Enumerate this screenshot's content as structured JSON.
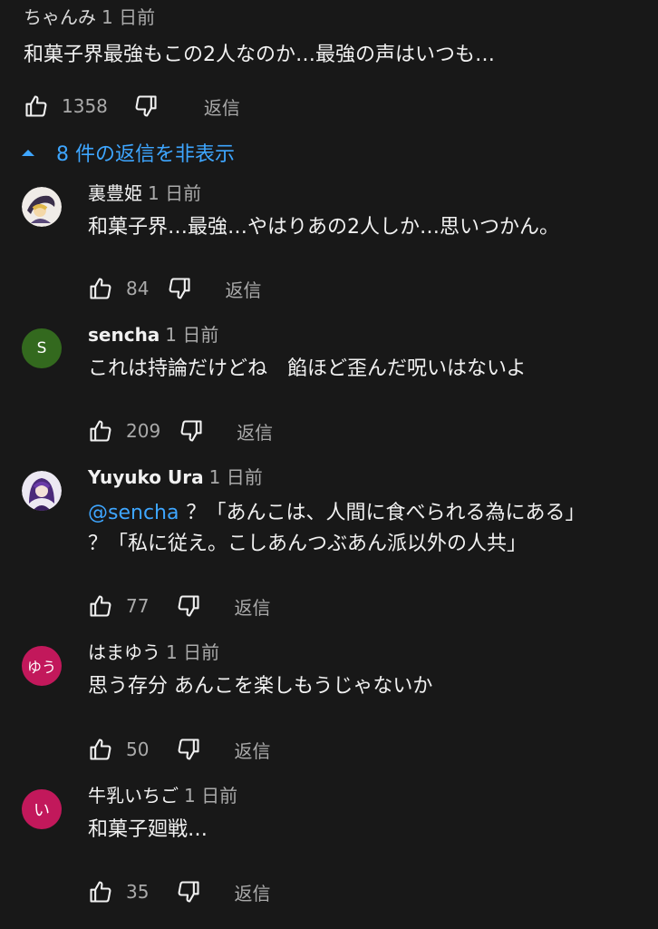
{
  "top_comment": {
    "author": "ちゃんみ",
    "time": "1 日前",
    "text": "和菓子界最強もこの2人なのか…最強の声はいつも…",
    "likes": "1358",
    "reply_label": "返信"
  },
  "replies_toggle": {
    "label": "8 件の返信を非表示"
  },
  "replies": [
    {
      "author": "裏豊姫",
      "time": "1 日前",
      "avatar_type": "image",
      "text": "和菓子界…最強…やはりあの2人しか…思いつかん。",
      "likes": "84",
      "reply_label": "返信"
    },
    {
      "author": "sencha",
      "time": "1 日前",
      "avatar_letter": "S",
      "avatar_color": "#33691e",
      "text": "これは持論だけどね　餡ほど歪んだ呪いはないよ",
      "likes": "209",
      "reply_label": "返信"
    },
    {
      "author": "Yuyuko Ura",
      "time": "1 日前",
      "avatar_type": "image",
      "mention": "@sencha",
      "text_line1": "？「あんこは、人間に食べられる為にある」",
      "text_line2": "？「私に従え。こしあんつぶあん派以外の人共」",
      "likes": "77",
      "reply_label": "返信"
    },
    {
      "author": "はまゆう",
      "time": "1 日前",
      "avatar_letter": "ゆう",
      "avatar_color": "#c2185b",
      "text": "思う存分 あんこを楽しもうじゃないか",
      "likes": "50",
      "reply_label": "返信"
    },
    {
      "author": "牛乳いちご",
      "time": "1 日前",
      "avatar_letter": "い",
      "avatar_color": "#c2185b",
      "text": "和菓子廻戦…",
      "likes": "35",
      "reply_label": "返信"
    }
  ],
  "icons": {
    "like": "thumbs-up-icon",
    "dislike": "thumbs-down-icon",
    "toggle": "caret-up-icon"
  },
  "colors": {
    "background": "#181818",
    "link": "#3ea6ff",
    "secondary_text": "#aaaaaa"
  }
}
